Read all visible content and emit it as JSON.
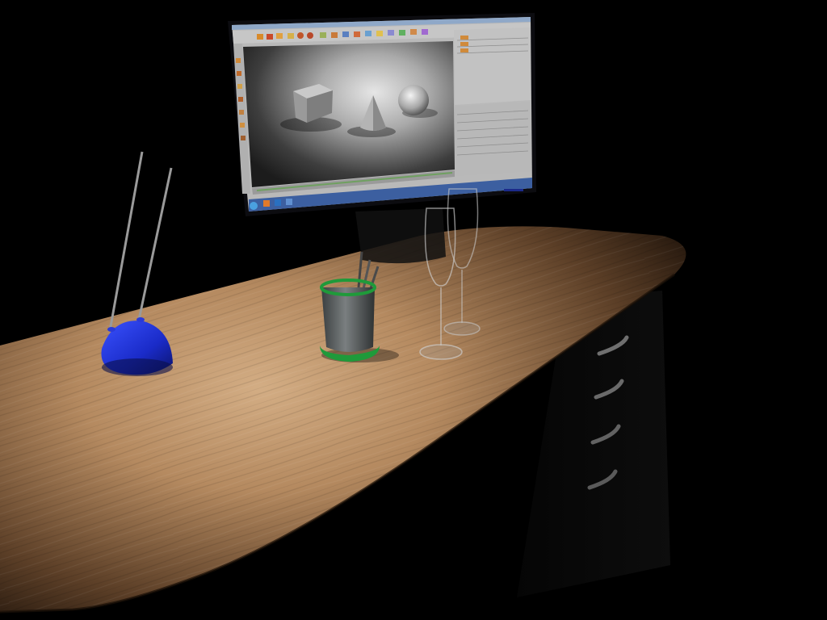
{
  "scene": {
    "colors": {
      "background": "#000000",
      "desk_wood_light": "#c9a27a",
      "desk_wood_mid": "#8a6544",
      "desk_wood_dark": "#3a2616",
      "lamp_base": "#1d2fd6",
      "pencil_cup_body": "#5b5f5f",
      "pencil_cup_rim": "#1f9a3a",
      "monitor_frame": "#0c0c10",
      "screen_ui": "#b9b9b9",
      "viewport_bg": "#2a2a2a",
      "viewport_light": "#d9d9d9",
      "taskbar": "#3c5fa0"
    },
    "objects": [
      {
        "name": "monitor",
        "icon": "monitor-icon"
      },
      {
        "name": "desk-lamp",
        "icon": "lamp-icon"
      },
      {
        "name": "pencil-cup",
        "icon": "cup-icon"
      },
      {
        "name": "wine-glass-front",
        "icon": "glass-icon"
      },
      {
        "name": "wine-glass-back",
        "icon": "glass-icon"
      },
      {
        "name": "desk-drawers",
        "icon": "drawer-icon"
      }
    ],
    "viewport_primitives": [
      "cube",
      "cone",
      "sphere"
    ]
  }
}
